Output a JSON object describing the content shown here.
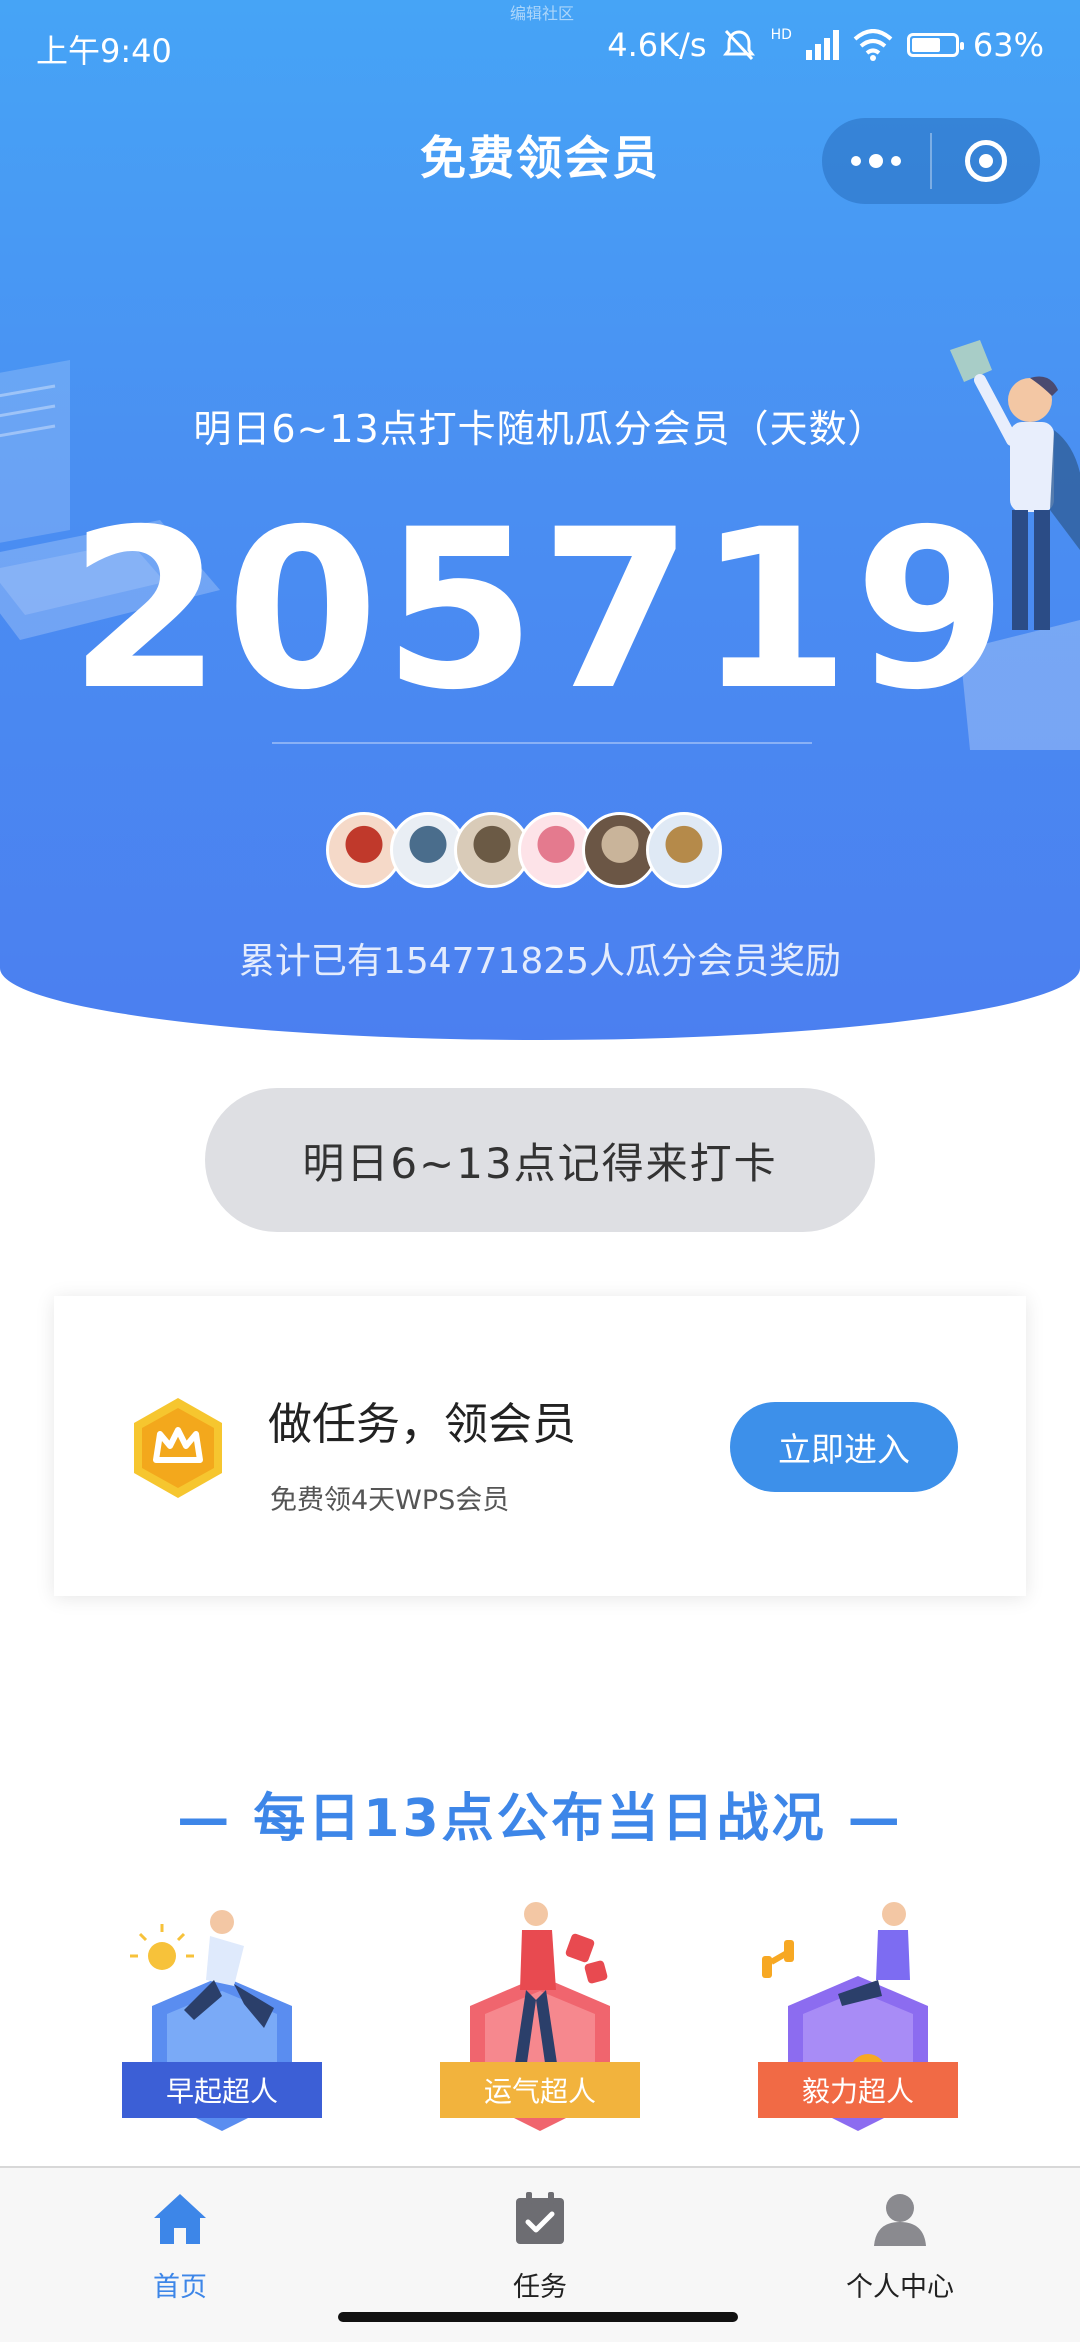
{
  "status_bar": {
    "time": "上午9:40",
    "top_hint": "编辑社区",
    "net_speed": "4.6K/s",
    "hd_label": "HD",
    "battery": "63%",
    "battery_level": 0.63
  },
  "nav": {
    "title": "免费领会员",
    "more_icon": "more-dots-icon",
    "close_icon": "target-icon"
  },
  "hero": {
    "subtitle": "明日6~13点打卡随机瓜分会员（天数）",
    "pool_days": "205719",
    "participants_text": "累计已有154771825人瓜分会员奖励",
    "avatar_count": 6,
    "colors": {
      "top": "#46a4f6",
      "bottom": "#4b7ff0"
    }
  },
  "checkin_button": {
    "label": "明日6~13点记得来打卡"
  },
  "task_card": {
    "title": "做任务，领会员",
    "description": "免费领4天WPS会员",
    "button": "立即进入",
    "icon": "crown-badge-icon",
    "accent": "#3d90ea"
  },
  "battle_section": {
    "title": "— 每日13点公布当日战况 —",
    "badges": [
      {
        "label": "早起超人",
        "color": "#4f7fe8",
        "ribbon": "#3c5fd6"
      },
      {
        "label": "运气超人",
        "color": "#f0656e",
        "ribbon": "#f2b33d"
      },
      {
        "label": "毅力超人",
        "color": "#8c6cf0",
        "ribbon": "#f16a45"
      }
    ]
  },
  "tabbar": {
    "items": [
      {
        "label": "首页",
        "icon": "home-icon",
        "active": true
      },
      {
        "label": "任务",
        "icon": "calendar-check-icon",
        "active": false
      },
      {
        "label": "个人中心",
        "icon": "user-icon",
        "active": false
      }
    ],
    "active_color": "#3d86e8"
  }
}
